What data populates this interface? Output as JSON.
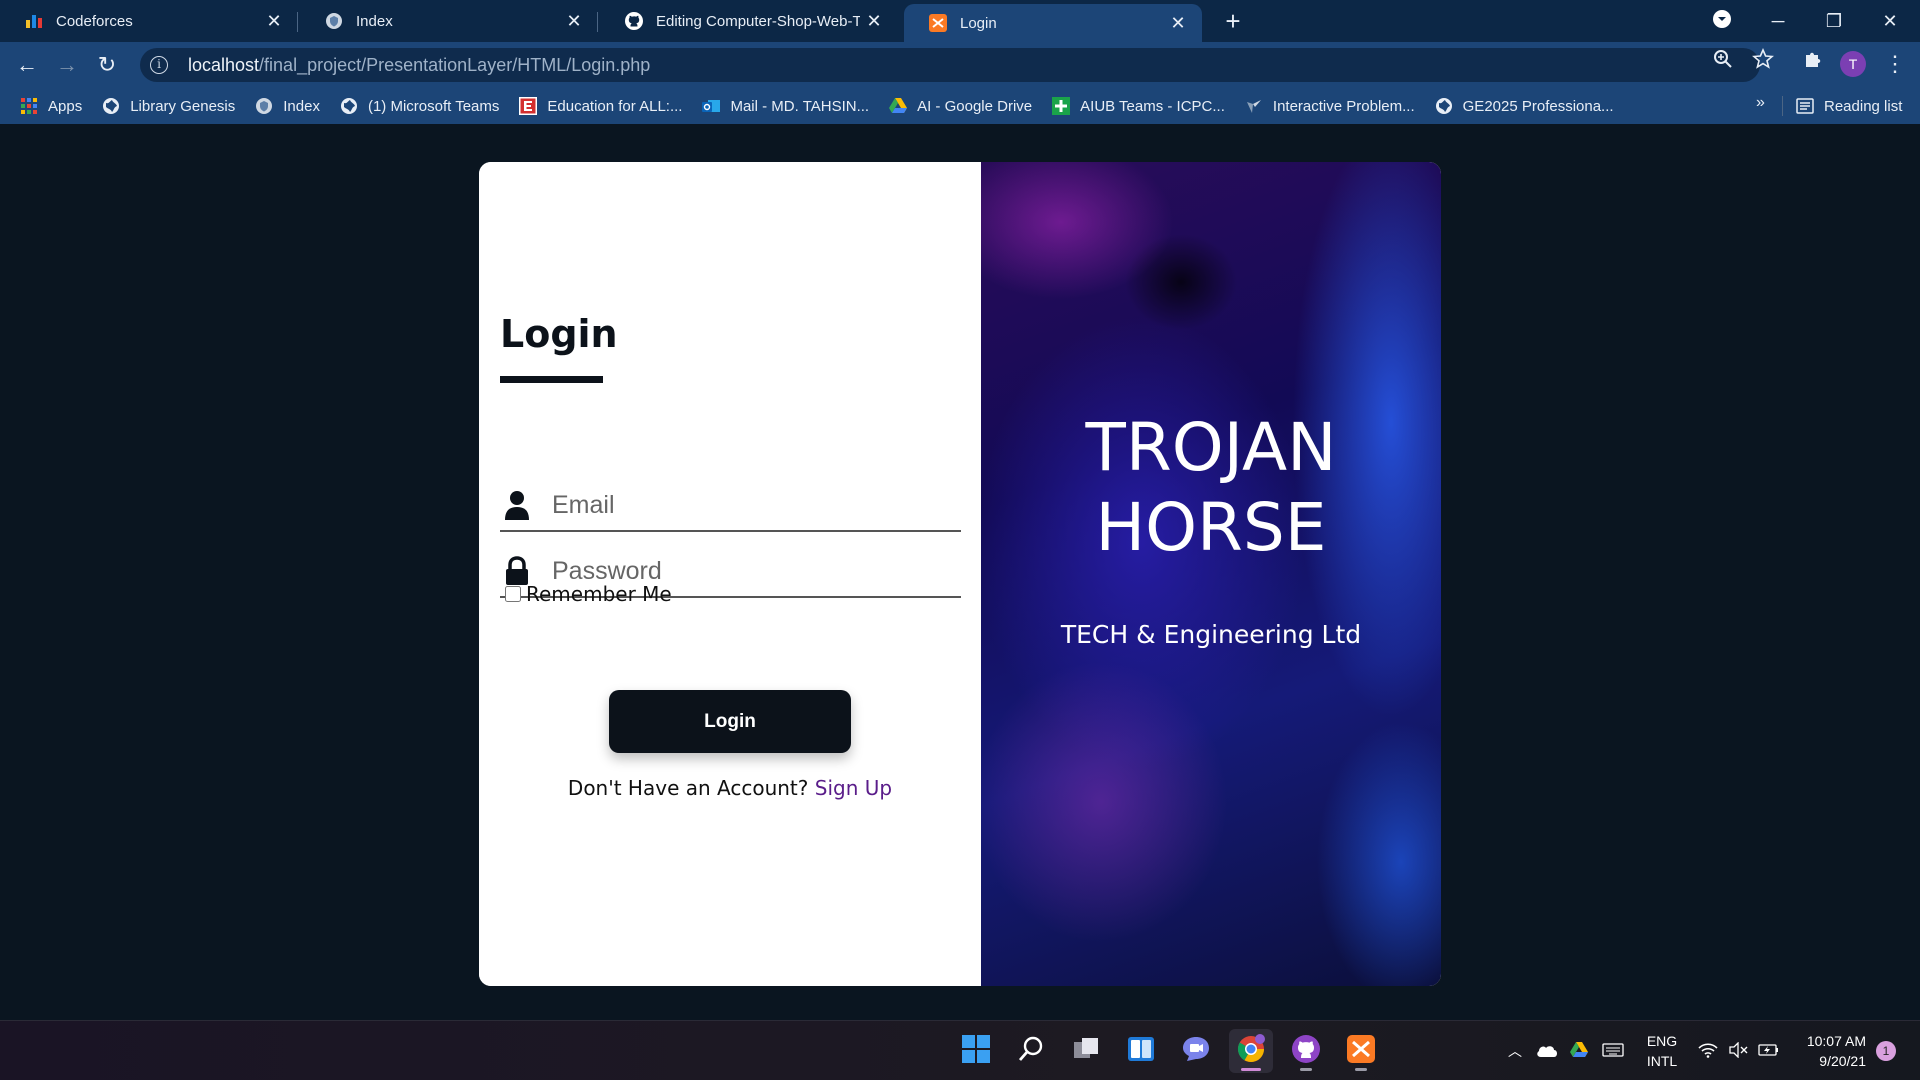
{
  "browser": {
    "tabs": [
      {
        "title": "Codeforces",
        "icon": "codeforces-icon"
      },
      {
        "title": "Index",
        "icon": "globe-shield-icon"
      },
      {
        "title": "Editing Computer-Shop-Web-Tec",
        "icon": "github-icon"
      },
      {
        "title": "Login",
        "icon": "xampp-icon",
        "active": true
      }
    ],
    "url_host": "localhost",
    "url_path": "/final_project/PresentationLayer/HTML/Login.php",
    "profile_initial": "T",
    "bookmarks": [
      {
        "label": "Apps",
        "icon": "apps-grid-icon"
      },
      {
        "label": "Library Genesis",
        "icon": "globe-icon"
      },
      {
        "label": "Index",
        "icon": "globe-shield-icon"
      },
      {
        "label": "(1) Microsoft Teams",
        "icon": "globe-icon"
      },
      {
        "label": "Education for ALL:...",
        "icon": "education-icon"
      },
      {
        "label": "Mail - MD. TAHSIN...",
        "icon": "outlook-icon"
      },
      {
        "label": "AI - Google Drive",
        "icon": "google-drive-icon"
      },
      {
        "label": "AIUB Teams - ICPC...",
        "icon": "plus-icon"
      },
      {
        "label": "Interactive Problem...",
        "icon": "codeforces-icon"
      },
      {
        "label": "GE2025 Professiona...",
        "icon": "globe-icon"
      }
    ],
    "bookmarks_more": "»",
    "reading_list": "Reading list"
  },
  "login": {
    "title": "Login",
    "email_placeholder": "Email",
    "password_placeholder": "Password",
    "remember_label": "Remember Me",
    "button_label": "Login",
    "signup_prompt": "Don't Have an Account?",
    "signup_link": "Sign Up"
  },
  "brand": {
    "name_line1": "TROJAN",
    "name_line2": "HORSE",
    "tagline": "TECH & Engineering Ltd"
  },
  "taskbar": {
    "lang_line1": "ENG",
    "lang_line2": "INTL",
    "time": "10:07 AM",
    "date": "9/20/21",
    "notifications": "1"
  },
  "colors": {
    "page_bg": "#0a1520",
    "button_bg": "#0c121a",
    "link": "#5a1d8a",
    "chrome_toolbar": "#1c4577"
  }
}
